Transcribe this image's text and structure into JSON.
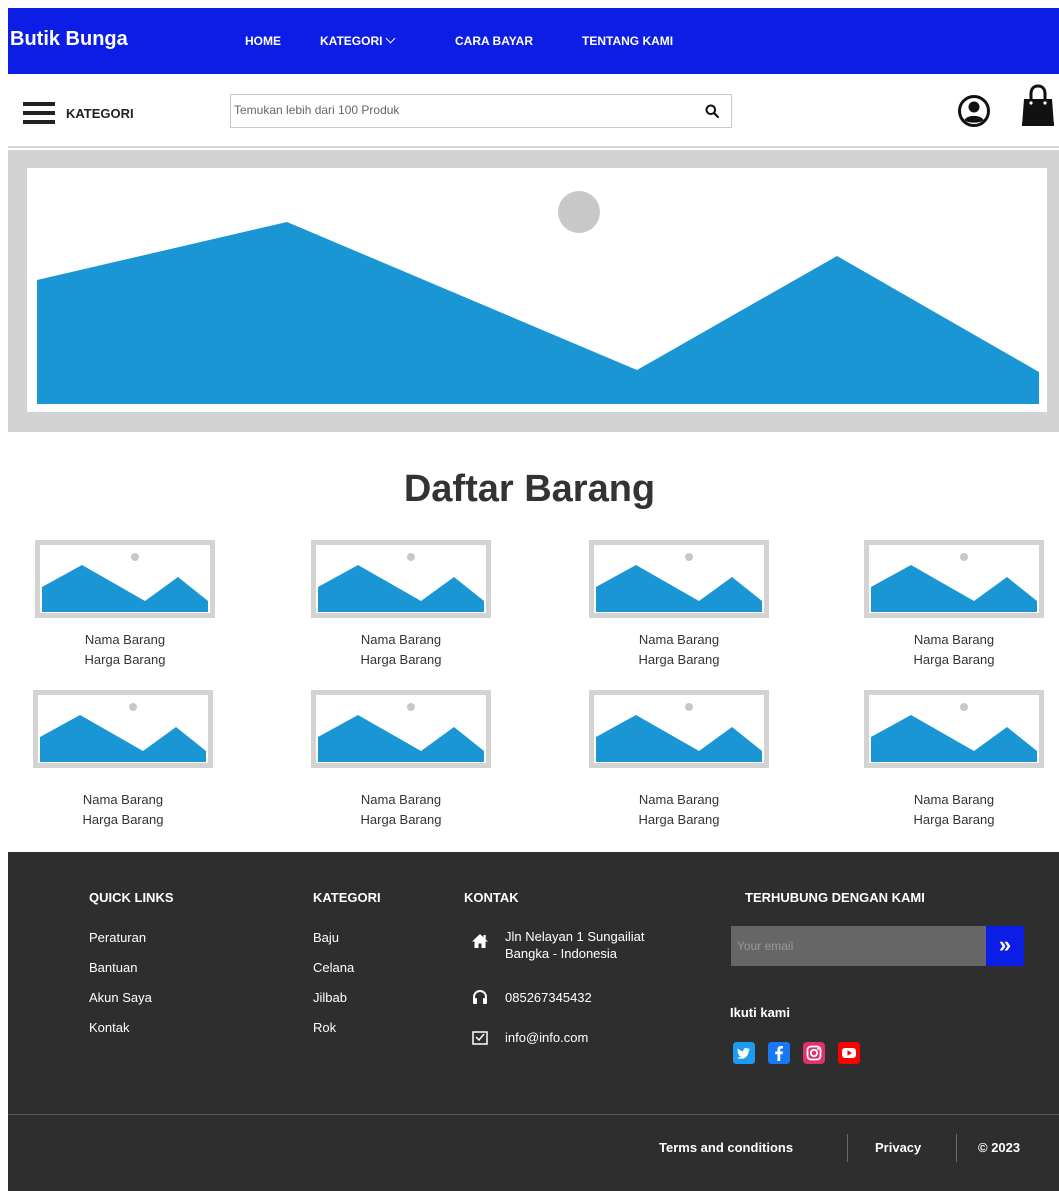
{
  "navbar": {
    "brand": "Butik Bunga",
    "links": [
      "HOME",
      "KATEGORI",
      "CARA BAYAR",
      "TENTANG KAMI"
    ]
  },
  "searchbar": {
    "category_label": "KATEGORI",
    "placeholder": "Temukan lebih dari 100 Produk"
  },
  "products": {
    "title": "Daftar Barang",
    "items": [
      {
        "name": "Nama Barang",
        "price": "Harga Barang"
      },
      {
        "name": "Nama Barang",
        "price": "Harga Barang"
      },
      {
        "name": "Nama Barang",
        "price": "Harga Barang"
      },
      {
        "name": "Nama Barang",
        "price": "Harga Barang"
      },
      {
        "name": "Nama Barang",
        "price": "Harga Barang"
      },
      {
        "name": "Nama Barang",
        "price": "Harga Barang"
      },
      {
        "name": "Nama Barang",
        "price": "Harga Barang"
      },
      {
        "name": "Nama Barang",
        "price": "Harga Barang"
      }
    ]
  },
  "footer": {
    "quick_links": {
      "heading": "QUICK LINKS",
      "items": [
        "Peraturan",
        "Bantuan",
        "Akun Saya",
        "Kontak"
      ]
    },
    "kategori": {
      "heading": "KATEGORI",
      "items": [
        "Baju",
        "Celana",
        "Jilbab",
        "Rok"
      ]
    },
    "kontak": {
      "heading": "KONTAK",
      "address_line1": "Jln Nelayan 1 Sungailiat",
      "address_line2": "Bangka - Indonesia",
      "phone": "085267345432",
      "email": "info@info.com"
    },
    "connect": {
      "heading": "TERHUBUNG DENGAN KAMI",
      "email_placeholder": "Your email",
      "follow_label": "Ikuti kami",
      "social_icons": [
        "twitter-icon",
        "facebook-icon",
        "instagram-icon",
        "youtube-icon"
      ]
    },
    "bottom": {
      "terms": "Terms and conditions",
      "privacy": "Privacy",
      "copyright": "© 2023"
    }
  },
  "colors": {
    "nav_blue": "#0c1ee6",
    "image_blue": "#1a96d4",
    "footer_bg": "#2e2e2e",
    "twitter": "#1d9bf0",
    "facebook": "#1877f2",
    "instagram": "#e1306c",
    "youtube": "#ff0000"
  }
}
